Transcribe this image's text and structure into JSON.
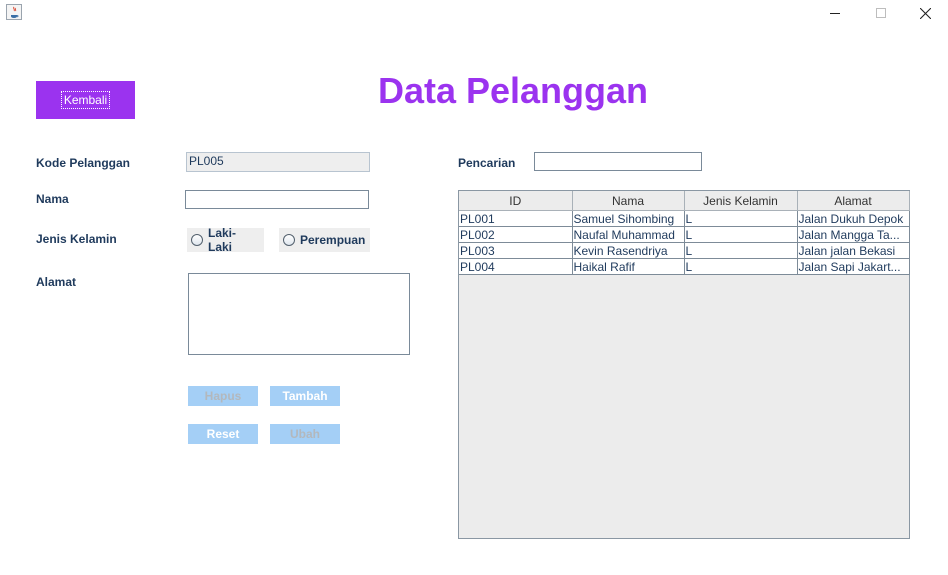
{
  "window": {
    "minimize_label": "minimize",
    "maximize_label": "maximize",
    "close_label": "close"
  },
  "header": {
    "back_label": "Kembali",
    "title": "Data Pelanggan"
  },
  "form": {
    "kode_label": "Kode Pelanggan",
    "kode_value": "PL005",
    "nama_label": "Nama",
    "nama_value": "",
    "jenis_label": "Jenis Kelamin",
    "radio_laki": "Laki-Laki",
    "radio_perempuan": "Perempuan",
    "alamat_label": "Alamat",
    "alamat_value": ""
  },
  "buttons": {
    "hapus": "Hapus",
    "tambah": "Tambah",
    "reset": "Reset",
    "ubah": "Ubah"
  },
  "search": {
    "label": "Pencarian",
    "value": ""
  },
  "table": {
    "columns": [
      "ID",
      "Nama",
      "Jenis Kelamin",
      "Alamat"
    ],
    "rows": [
      [
        "PL001",
        "Samuel Sihombing",
        "L",
        "Jalan Dukuh Depok"
      ],
      [
        "PL002",
        "Naufal Muhammad",
        "L",
        "Jalan Mangga Ta..."
      ],
      [
        "PL003",
        "Kevin Rasendriya",
        "L",
        "Jalan jalan Bekasi"
      ],
      [
        "PL004",
        "Haikal Rafif",
        "L",
        "Jalan Sapi Jakart..."
      ]
    ]
  }
}
